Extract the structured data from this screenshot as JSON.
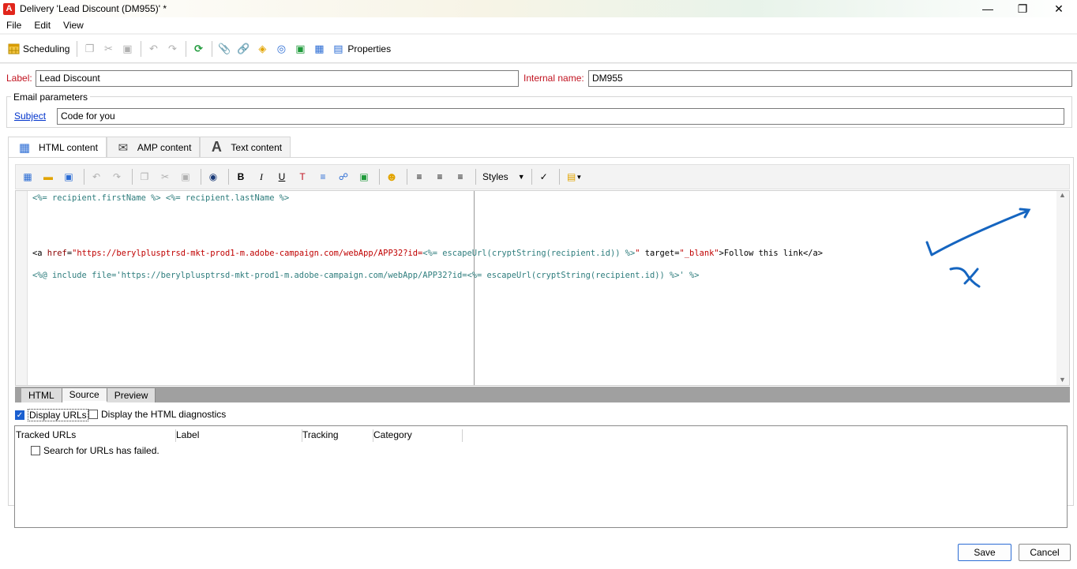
{
  "window": {
    "title": "Delivery 'Lead Discount (DM955)' *",
    "app_icon_letter": "A"
  },
  "menu": [
    "File",
    "Edit",
    "View"
  ],
  "toolbar": {
    "scheduling_label": "Scheduling",
    "properties_label": "Properties"
  },
  "form": {
    "label_caption": "Label:",
    "label_value": "Lead Discount",
    "internal_name_caption": "Internal name:",
    "internal_name_value": "DM955",
    "email_params_legend": "Email parameters",
    "subject_caption": "Subject",
    "subject_value": "Code for you"
  },
  "content_tabs": [
    {
      "label": "HTML content",
      "active": true
    },
    {
      "label": "AMP content",
      "active": false
    },
    {
      "label": "Text content",
      "active": false
    }
  ],
  "editor": {
    "styles_label": "Styles",
    "code_lines": [
      "<%= recipient.firstName %> <%= recipient.lastName %>",
      "",
      "<a href=\"https://berylplusptrsd-mkt-prod1-m.adobe-campaign.com/webApp/APP32?id=<%= escapeUrl(cryptString(recipient.id)) %>\" target=\"_blank\">Follow this link</a>",
      "<%@ include file='https://berylplusptrsd-mkt-prod1-m.adobe-campaign.com/webApp/APP32?id=<%= escapeUrl(cryptString(recipient.id)) %>' %>"
    ],
    "view_tabs": [
      {
        "label": "HTML",
        "active": false
      },
      {
        "label": "Source",
        "active": true
      },
      {
        "label": "Preview",
        "active": false
      }
    ]
  },
  "options": {
    "display_urls_label": "Display URLs",
    "display_urls_checked": true,
    "display_diagnostics_label": "Display the HTML diagnostics",
    "display_diagnostics_checked": false
  },
  "url_table": {
    "columns": [
      "Tracked URLs",
      "Label",
      "Tracking",
      "Category"
    ],
    "message": "Search for URLs has failed."
  },
  "buttons": {
    "save": "Save",
    "cancel": "Cancel"
  },
  "colors": {
    "accent": "#1a5fd0",
    "required_label": "#c1121f",
    "annotation_ink": "#1565c0"
  }
}
